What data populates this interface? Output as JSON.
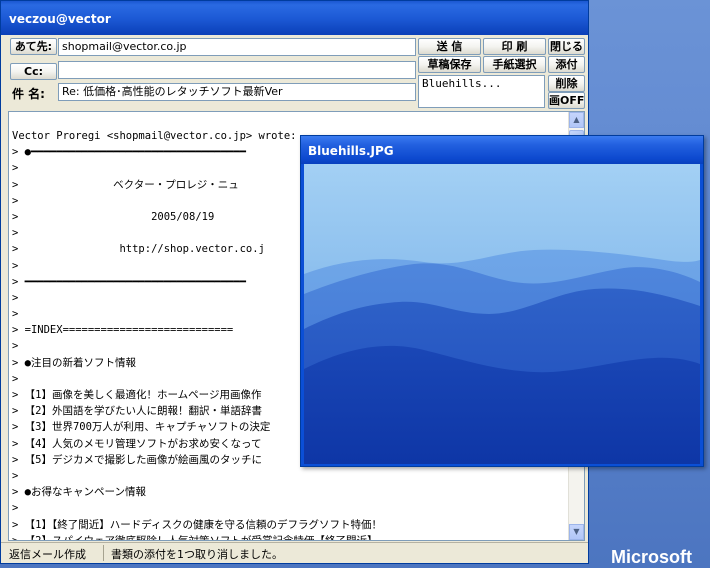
{
  "desktop": {
    "logo_text": "Microsoft"
  },
  "window": {
    "title": "veczou@vector"
  },
  "compose": {
    "to_label": "あて先:",
    "to_value": "shopmail@vector.co.jp",
    "cc_label": "Cc:",
    "cc_value": "",
    "subject_label": "件 名:",
    "subject_value": "Re: 低価格･高性能のレタッチソフト最新Ver",
    "attachment_value": "Bluehills..."
  },
  "buttons": {
    "send": "送 信",
    "print": "印 刷",
    "close": "閉じる",
    "save_draft": "草稿保存",
    "stationery": "手紙選択",
    "attach": "添付",
    "delete": "削除",
    "image_off": "画OFF"
  },
  "body_lines": [
    "Vector Proregi <shopmail@vector.co.jp> wrote:",
    "> ●━━━━━━━━━━━━━━━━━━━━━━━━━━━━━━━━━━",
    ">",
    ">               ベクター・プロレジ・ニュ",
    ">",
    ">                     2005/08/19",
    ">",
    ">                http://shop.vector.co.j",
    ">",
    "> ━━━━━━━━━━━━━━━━━━━━━━━━━━━━━━━━━━━",
    ">",
    ">",
    "> =INDEX===========================",
    ">",
    "> ●注目の新着ソフト情報",
    ">",
    "> 【1】画像を美しく最適化！ホームページ用画像作",
    "> 【2】外国語を学びたい人に朗報！翻訳・単語辞書",
    "> 【3】世界700万人が利用、キャプチャソフトの決定",
    "> 【4】人気のメモリ管理ソフトがお求め安くなって",
    "> 【5】デジカメで撮影した画像が絵画風のタッチに",
    ">",
    "> ●お得なキャンペーン情報",
    ">",
    "> 【1】【終了間近】ハードディスクの健康を守る信頼のデフラグソフト特価！",
    "> 【2】スパイウェア徹底駆除！人気対策ソフトが受賞記念特価【終了間近】"
  ],
  "status": {
    "mode": "返信メール作成",
    "message": "書類の添付を1つ取り消しました。"
  },
  "image_window": {
    "title": "Bluehills.JPG"
  },
  "colors": {
    "titlebar": "#0a3fb8",
    "desktop": "#5e86cf",
    "sky_top": "#8fc3ef",
    "hills_far": "#5f98e2",
    "hills_near": "#1141b8"
  }
}
